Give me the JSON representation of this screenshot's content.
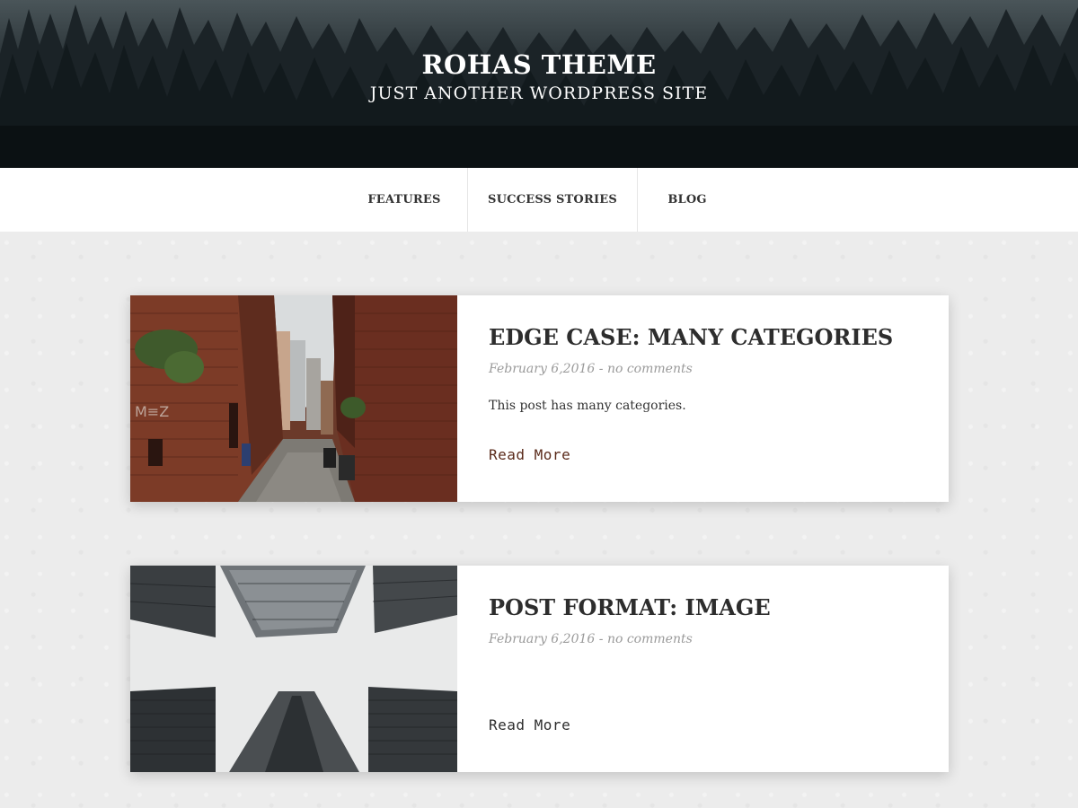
{
  "header": {
    "site_title": "ROHAS THEME",
    "tagline": "JUST ANOTHER WORDPRESS SITE"
  },
  "nav": {
    "items": [
      {
        "label": "FEATURES"
      },
      {
        "label": "SUCCESS STORIES"
      },
      {
        "label": "BLOG"
      }
    ]
  },
  "posts": [
    {
      "title": "EDGE CASE: MANY CATEGORIES",
      "date": "February 6,2016",
      "separator": " - ",
      "comments": "no comments",
      "excerpt": "This post has many categories.",
      "read_more": "Read More",
      "image": "alley-brick-buildings-photo"
    },
    {
      "title": "POST FORMAT: IMAGE",
      "date": "February 6,2016",
      "separator": " - ",
      "comments": "no comments",
      "excerpt": "",
      "read_more": "Read More",
      "image": "skyscrapers-looking-up-photo"
    }
  ],
  "colors": {
    "nav_bg": "#ffffff",
    "content_bg": "#ececec",
    "title_text": "#2d2d2d",
    "meta_text": "#9a9a9a",
    "read_more_1": "#5a2a1a",
    "read_more_2": "#2d2d2d"
  }
}
